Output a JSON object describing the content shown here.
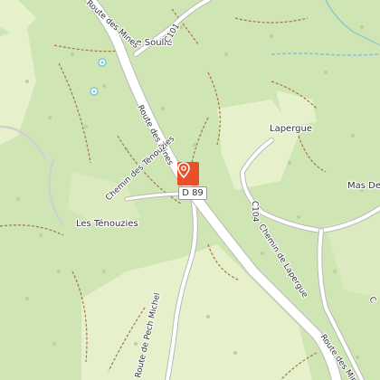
{
  "map": {
    "places": {
      "soulie": "Le Soulié",
      "lapergue": "Lapergue",
      "tenouzies": "Les Ténouzies",
      "mas": "Mas De"
    },
    "roads": {
      "route_des_mines_top": "Route des Mines",
      "route_des_mines_mid": "Route des Mines",
      "route_des_mines_bottom": "Route des Mines",
      "c101": "C101",
      "c104": "C104",
      "chemin_tenouzies": "Chemin des Ténouzies",
      "chemin_lapergue": "Chemin de Lapergue",
      "route_pech_michel": "Route de Pech Michel",
      "route_partial_c": "C"
    },
    "route_shield": "D 89",
    "marker": {
      "icon": "map-pin-icon",
      "color": "#e8502a"
    },
    "colors": {
      "forest": "#cfe5b3",
      "meadow": "#e6f1cc",
      "road": "#ffffff",
      "road_casing": "#b9b9b9",
      "water": "#7ec5d6",
      "trail": "#a5763c"
    }
  }
}
